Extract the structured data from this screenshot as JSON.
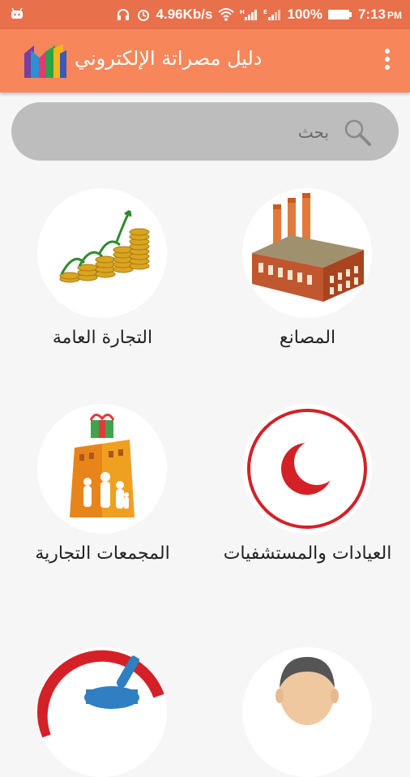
{
  "status_bar": {
    "speed": "4.96Kb/s",
    "battery": "100%",
    "time": "7:13",
    "ampm": "PM"
  },
  "app_bar": {
    "title": "دليل مصراتة الإلكتروني"
  },
  "search": {
    "placeholder": "بحث"
  },
  "categories": [
    {
      "label": "المصانع",
      "icon": "factory-icon"
    },
    {
      "label": "التجارة العامة",
      "icon": "coins-growth-icon"
    },
    {
      "label": "العيادات والمستشفيات",
      "icon": "red-crescent-icon"
    },
    {
      "label": "المجمعات التجارية",
      "icon": "shopping-mall-icon"
    },
    {
      "label": "",
      "icon": "person-icon"
    },
    {
      "label": "",
      "icon": "pharmacy-icon"
    }
  ],
  "colors": {
    "status_bar": "#e8704b",
    "app_bar": "#f7865b",
    "search_bg": "#bdbdbd",
    "background": "#f6f6f6"
  }
}
